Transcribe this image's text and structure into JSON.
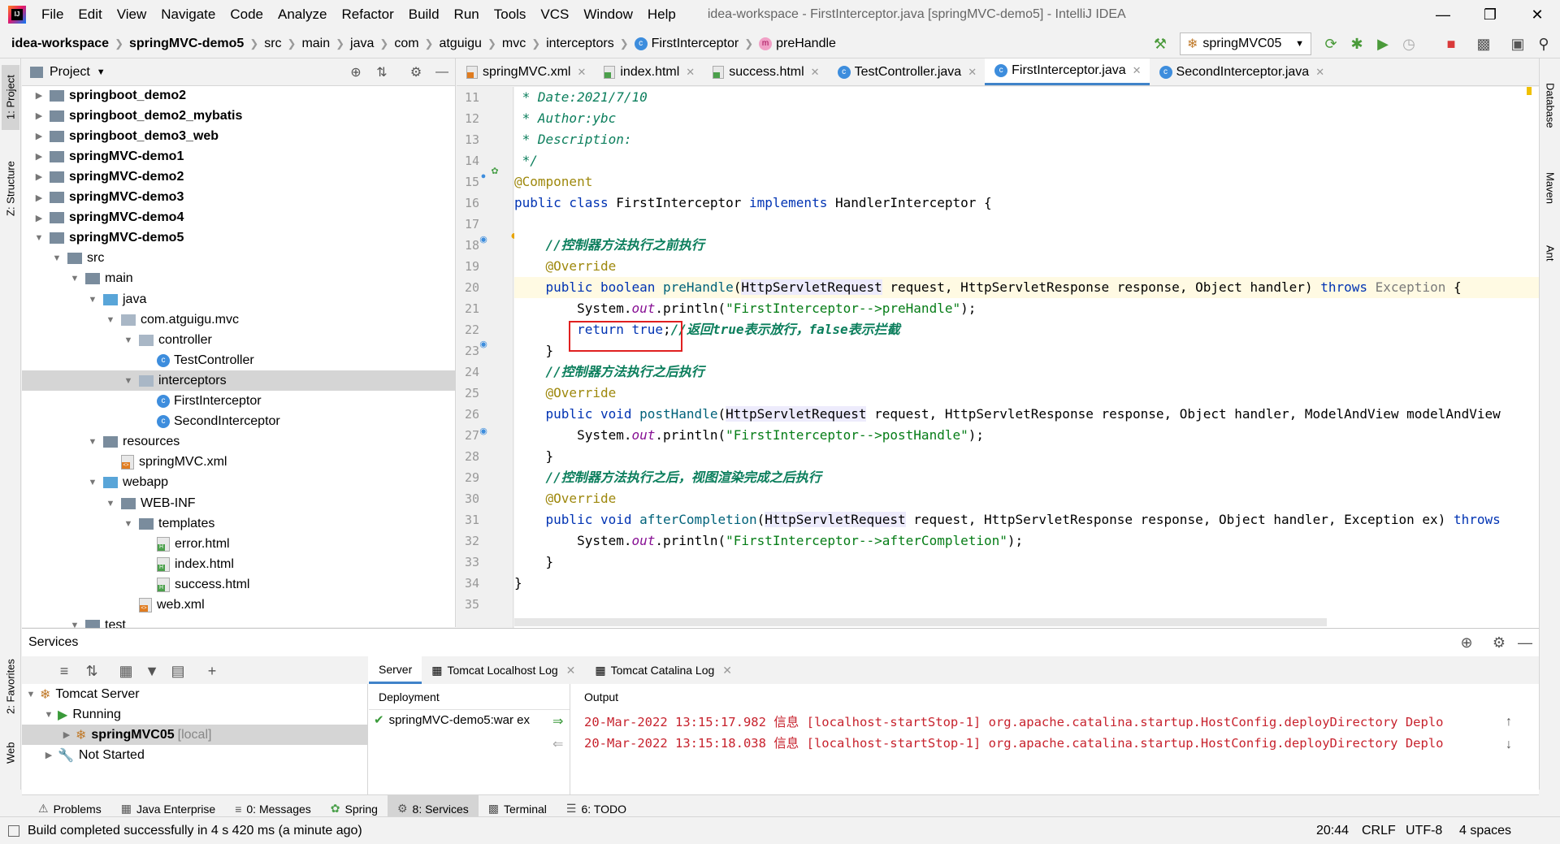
{
  "menu": {
    "items": [
      "File",
      "Edit",
      "View",
      "Navigate",
      "Code",
      "Analyze",
      "Refactor",
      "Build",
      "Run",
      "Tools",
      "VCS",
      "Window",
      "Help"
    ],
    "window_title": "idea-workspace - FirstInterceptor.java [springMVC-demo5] - IntelliJ IDEA"
  },
  "nav": {
    "crumbs": [
      "idea-workspace",
      "springMVC-demo5",
      "src",
      "main",
      "java",
      "com",
      "atguigu",
      "mvc",
      "interceptors",
      "FirstInterceptor",
      "preHandle"
    ],
    "run_config": "springMVC05"
  },
  "left_strip": {
    "project": "1: Project",
    "structure": "Z: Structure",
    "favorites": "2: Favorites",
    "web": "Web"
  },
  "right_strip": {
    "database": "Database",
    "maven": "Maven",
    "ant": "Ant"
  },
  "project": {
    "header": "Project",
    "tree": [
      {
        "label": "springboot_demo2",
        "bold": true
      },
      {
        "label": "springboot_demo2_mybatis",
        "bold": true
      },
      {
        "label": "springboot_demo3_web",
        "bold": true
      },
      {
        "label": "springMVC-demo1",
        "bold": true
      },
      {
        "label": "springMVC-demo2",
        "bold": true
      },
      {
        "label": "springMVC-demo3",
        "bold": true
      },
      {
        "label": "springMVC-demo4",
        "bold": true
      },
      {
        "label": "springMVC-demo5",
        "bold": true
      },
      {
        "label": "src"
      },
      {
        "label": "main"
      },
      {
        "label": "java"
      },
      {
        "label": "com.atguigu.mvc"
      },
      {
        "label": "controller"
      },
      {
        "label": "TestController"
      },
      {
        "label": "interceptors"
      },
      {
        "label": "FirstInterceptor"
      },
      {
        "label": "SecondInterceptor"
      },
      {
        "label": "resources"
      },
      {
        "label": "springMVC.xml"
      },
      {
        "label": "webapp"
      },
      {
        "label": "WEB-INF"
      },
      {
        "label": "templates"
      },
      {
        "label": "error.html"
      },
      {
        "label": "index.html"
      },
      {
        "label": "success.html"
      },
      {
        "label": "web.xml"
      },
      {
        "label": "test"
      }
    ]
  },
  "editor_tabs": [
    "springMVC.xml",
    "index.html",
    "success.html",
    "TestController.java",
    "FirstInterceptor.java",
    "SecondInterceptor.java"
  ],
  "editor": {
    "line_numbers": [
      "11",
      "12",
      "13",
      "14",
      "15",
      "16",
      "17",
      "18",
      "19",
      "20",
      "21",
      "22",
      "23",
      "24",
      "25",
      "26",
      "27",
      "28",
      "29",
      "30",
      "31",
      "32",
      "33",
      "34",
      "35"
    ],
    "lines": {
      "l11": " * Date:2021/7/10",
      "l12": " * Author:ybc",
      "l13": " * Description:",
      "l14": " */",
      "l15": "@Component",
      "l16_a": "public class ",
      "l16_b": "FirstInterceptor ",
      "l16_c": "implements ",
      "l16_d": "HandlerInterceptor {",
      "l18": "    //控制器方法执行之前执行",
      "l19": "    @Override",
      "l20_a": "    public boolean ",
      "l20_b": "preHandle",
      "l20_c": "(",
      "l20_d": "HttpServletRequest",
      "l20_e": " request, HttpServletResponse response, Object handler) ",
      "l20_f": "throws ",
      "l20_g": "Exception",
      "l20_h": " {",
      "l21_a": "        System.",
      "l21_b": "out",
      "l21_c": ".println(",
      "l21_d": "\"FirstInterceptor-->preHandle\"",
      "l21_e": ");",
      "l22_a": "        return true",
      "l22_b": ";",
      "l22_c": "//返回true表示放行，false表示拦截",
      "l23": "    }",
      "l24": "    //控制器方法执行之后执行",
      "l25": "    @Override",
      "l26_a": "    public void ",
      "l26_b": "postHandle",
      "l26_c": "(",
      "l26_d": "HttpServletRequest",
      "l26_e": " request, HttpServletResponse response, Object handler, ModelAndView modelAndView",
      "l27_a": "        System.",
      "l27_b": "out",
      "l27_c": ".println(",
      "l27_d": "\"FirstInterceptor-->postHandle\"",
      "l27_e": ");",
      "l28": "    }",
      "l29": "    //控制器方法执行之后，视图渲染完成之后执行",
      "l30": "    @Override",
      "l31_a": "    public void ",
      "l31_b": "afterCompletion",
      "l31_c": "(",
      "l31_d": "HttpServletRequest",
      "l31_e": " request, HttpServletResponse response, Object handler, Exception ex) ",
      "l31_f": "throws",
      "l32_a": "        System.",
      "l32_b": "out",
      "l32_c": ".println(",
      "l32_d": "\"FirstInterceptor-->afterCompletion\"",
      "l32_e": ");",
      "l33": "    }",
      "l34": "}"
    }
  },
  "services": {
    "title": "Services",
    "tree": [
      {
        "label": "Tomcat Server"
      },
      {
        "label": "Running"
      },
      {
        "label": "springMVC05",
        "suffix": "[local]"
      },
      {
        "label": "Not Started"
      }
    ],
    "tabs": [
      "Server",
      "Tomcat Localhost Log",
      "Tomcat Catalina Log"
    ],
    "deployment_header": "Deployment",
    "deployment_item": "springMVC-demo5:war ex",
    "output_header": "Output",
    "output_lines": [
      "20-Mar-2022 13:15:17.982 信息 [localhost-startStop-1] org.apache.catalina.startup.HostConfig.deployDirectory Deplo",
      "20-Mar-2022 13:15:18.038 信息 [localhost-startStop-1] org.apache.catalina.startup.HostConfig.deployDirectory Deplo"
    ]
  },
  "bottom_tabs": [
    "Problems",
    "Java Enterprise",
    "0: Messages",
    "Spring",
    "8: Services",
    "Terminal",
    "6: TODO"
  ],
  "status": {
    "message": "Build completed successfully in 4 s 420 ms (a minute ago)",
    "position": "20:44",
    "line_sep": "CRLF",
    "encoding": "UTF-8",
    "indent": "4 spaces"
  },
  "colors": {
    "accent": "#4083c9",
    "highlight_box": "#e02020",
    "error_output": "#c7222d"
  }
}
